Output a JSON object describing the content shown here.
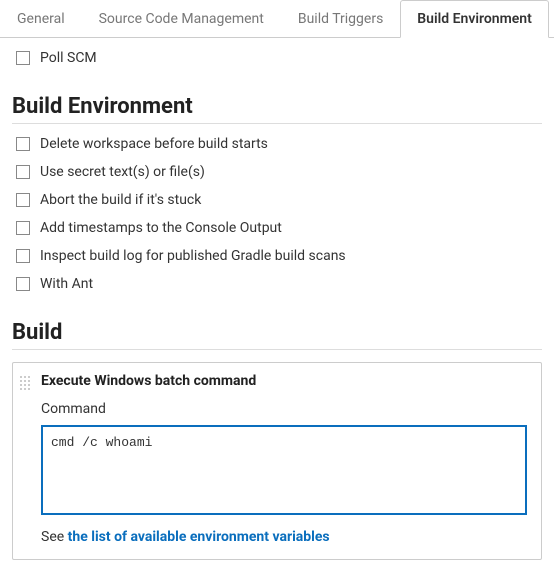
{
  "tabs": {
    "general": "General",
    "scm": "Source Code Management",
    "triggers": "Build Triggers",
    "env": "Build Environment"
  },
  "triggers": {
    "poll_scm": "Poll SCM"
  },
  "sections": {
    "build_env": "Build Environment",
    "build": "Build"
  },
  "build_env": {
    "delete_workspace": "Delete workspace before build starts",
    "use_secret": "Use secret text(s) or file(s)",
    "abort_stuck": "Abort the build if it's stuck",
    "timestamps": "Add timestamps to the Console Output",
    "gradle_scans": "Inspect build log for published Gradle build scans",
    "with_ant": "With Ant"
  },
  "build_step": {
    "title": "Execute Windows batch command",
    "command_label": "Command",
    "command_value_plain": "cmd /c whoami",
    "help_prefix": "See ",
    "help_link": "the list of available environment variables"
  }
}
